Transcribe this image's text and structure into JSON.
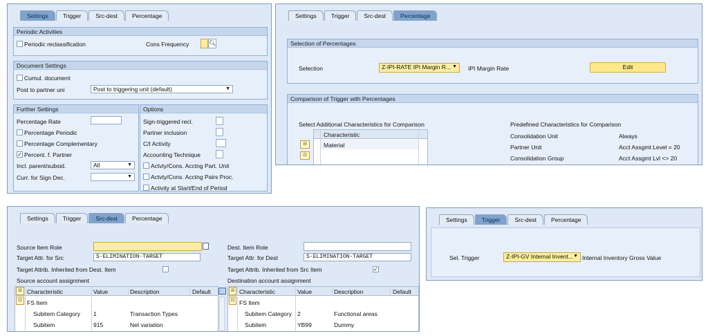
{
  "p1": {
    "tabs": [
      "Settings",
      "Trigger",
      "Src-dest",
      "Percentage"
    ],
    "periodic": {
      "title": "Periodic Activities",
      "reclass": "Periodic reclassification",
      "cons_freq": "Cons Frequency"
    },
    "docset": {
      "title": "Document Settings",
      "cumul": "Cumul. document",
      "post_label": "Post to partner uni",
      "post_value": "Post to triggering unit (default)"
    },
    "further": {
      "title": "Further Settings",
      "rate": "Percentage Rate",
      "periodic": "Percentage Periodic",
      "complementary": "Percentage Complementary",
      "percent_partner": "Percent. f. Partner",
      "incl": "Incl. parent/subsid.",
      "incl_value": "All",
      "curr": "Curr. for Sign Dec."
    },
    "options": {
      "title": "Options",
      "sign": "Sign-triggered recl.",
      "partner": "Partner inclusion",
      "ci": "C/I Activity",
      "acct_tech": "Accounting Technique",
      "actvty_part": "Actvty/Cons. Acctng Part. Unit",
      "actvty_pairs": "Actvty/Cons. Acctng Pairs Proc.",
      "activity_start": "Activity at Start/End of Period"
    }
  },
  "p2": {
    "tabs": [
      "Settings",
      "Trigger",
      "Src-dest",
      "Percentage"
    ],
    "sel_title": "Selection of Percentages",
    "selection_label": "Selection",
    "selection_value": "Z-IPI-RATE IPI Margin R...",
    "selection_desc": "IPI Margin Rate",
    "edit": "Edit",
    "cmp_title": "Comparison of Trigger with Percentages",
    "select_add": "Select Additional Characteristics for Comparison",
    "char_header": "Characteristic",
    "char_row": "Material",
    "predef": "Predefined Characteristics for Comparison",
    "predef_rows": [
      {
        "name": "Consolidation Unit",
        "value": "Always"
      },
      {
        "name": "Partner Unit",
        "value": "Acct Assgmt Level = 20"
      },
      {
        "name": "Consolidation Group",
        "value": "Acct Assgmt Lvl <> 20"
      }
    ]
  },
  "p3": {
    "tabs": [
      "Settings",
      "Trigger",
      "Src-dest",
      "Percentage"
    ],
    "src_role": "Source Item Role",
    "src_attr": "Target Attr. for Src",
    "src_attr_value": "S-ELIMINATION-TARGET",
    "src_inh": "Target Attrib. Inherited from Dest. Item",
    "src_acct": "Source account assignment",
    "dst_role": "Dest. Item Role",
    "dst_attr": "Target Attr. for Dest",
    "dst_attr_value": "S-ELIMINATION-TARGET",
    "dst_inh": "Target Attrib. Inherited from Src Item",
    "dst_acct": "Destination account assignment",
    "cols": [
      "Characteristic",
      "Value",
      "Description",
      "Default"
    ],
    "src_rows": [
      {
        "c": "FS Item",
        "v": "",
        "d": ""
      },
      {
        "c": "Subitem Category",
        "v": "1",
        "d": "Transaction Types"
      },
      {
        "c": "Subitem",
        "v": "915",
        "d": "Net variation"
      }
    ],
    "dst_rows": [
      {
        "c": "FS Item",
        "v": "",
        "d": ""
      },
      {
        "c": "Subitem Category",
        "v": "2",
        "d": "Functional areas"
      },
      {
        "c": "Subitem",
        "v": "YB99",
        "d": "Dummy"
      }
    ]
  },
  "p4": {
    "tabs": [
      "Settings",
      "Trigger",
      "Src-dest",
      "Percentage"
    ],
    "label": "Sel. Trigger",
    "value": "Z-IPI-GV Internal Invent...",
    "desc": "Internal Inventory Gross Value"
  },
  "colors": {
    "panel": "#dfe8f6",
    "active_tab": "#7fa3cc",
    "highlight": "#fbeea4"
  }
}
